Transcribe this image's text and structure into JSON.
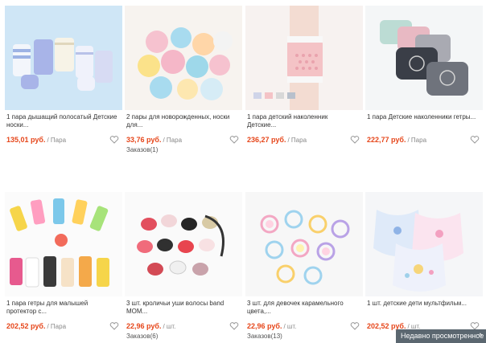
{
  "products": [
    {
      "title": "1 пара дышащий полосатый Детские носки...",
      "price": "135,01 руб.",
      "unit": "/ Пара",
      "orders": "",
      "icon": "socks-image"
    },
    {
      "title": "2 пары для новорожденных, носки для...",
      "price": "33,76 руб.",
      "unit": "/ Пара",
      "orders": "Заказов(1)",
      "icon": "candy-socks-image"
    },
    {
      "title": "1 пара детский наколенник Детские...",
      "price": "236,27 руб.",
      "unit": "/ Пара",
      "orders": "",
      "icon": "knee-pad-image"
    },
    {
      "title": "1 пара Детские наколенники гетры...",
      "price": "222,77 руб.",
      "unit": "/ Пара",
      "orders": "",
      "icon": "knee-pads-set-image"
    },
    {
      "title": "1 пара гетры для малышей протектор с...",
      "price": "202,52 руб.",
      "unit": "/ Пара",
      "orders": "",
      "icon": "leg-warmers-image"
    },
    {
      "title": "3 шт. кроличьи уши волосы band MOM...",
      "price": "22,96 руб.",
      "unit": "/ шт.",
      "orders": "Заказов(6)",
      "icon": "bunny-hair-ties-image"
    },
    {
      "title": "3 шт. для девочек карамельного цвета,...",
      "price": "22,96 руб.",
      "unit": "/ шт.",
      "orders": "Заказов(13)",
      "icon": "candy-hair-ties-image"
    },
    {
      "title": "1 шт. детские дети мультфильм...",
      "price": "202,52 руб.",
      "unit": "/ шт.",
      "orders": "",
      "icon": "bibs-image"
    }
  ],
  "recently_viewed": {
    "label": "Недавно просмотренное",
    "chevron": "^"
  },
  "colors": {
    "price": "#e6461a",
    "recent_bar": "#5b6770"
  }
}
